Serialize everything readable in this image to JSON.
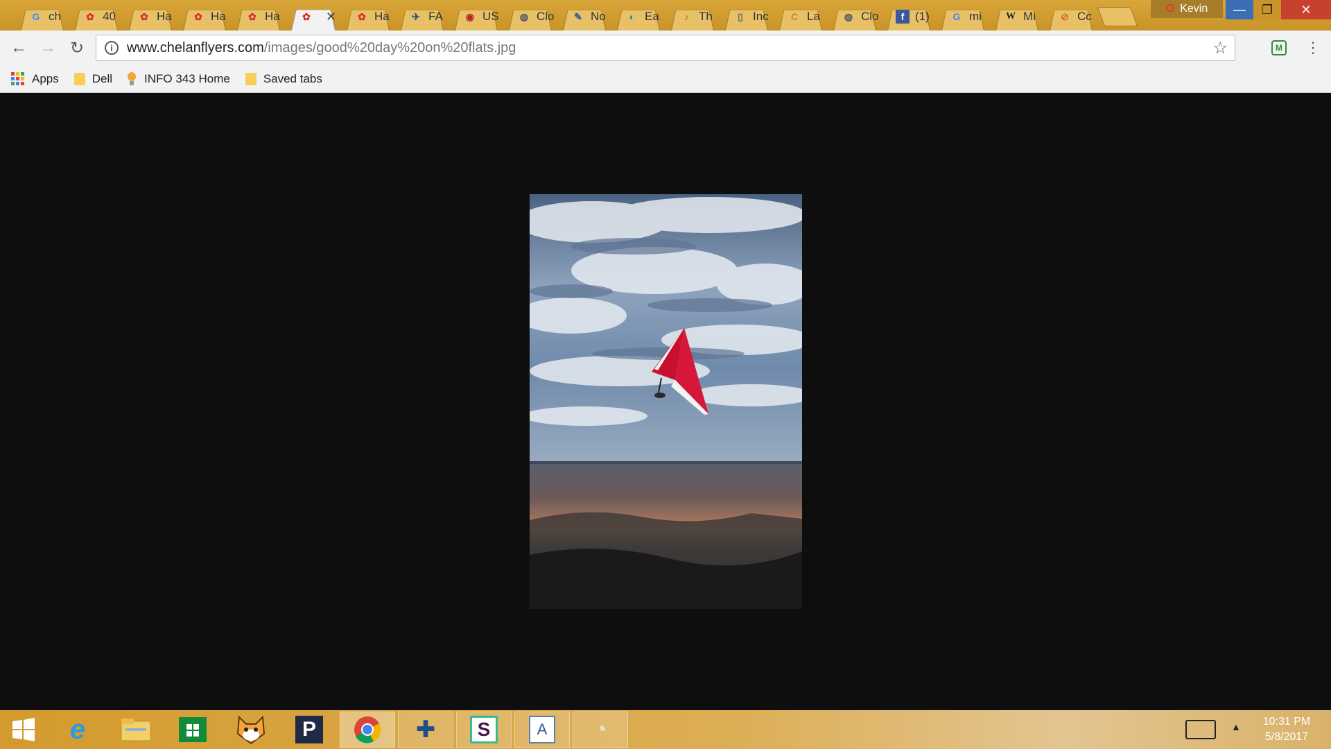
{
  "tabs": [
    {
      "label": "ch",
      "icon": "google-icon",
      "active": false
    },
    {
      "label": "40",
      "icon": "flower-icon",
      "active": false
    },
    {
      "label": "Ha",
      "icon": "flower-icon",
      "active": false
    },
    {
      "label": "Ha",
      "icon": "flower-icon",
      "active": false
    },
    {
      "label": "Ha",
      "icon": "flower-icon",
      "active": false
    },
    {
      "label": "",
      "icon": "flower-icon",
      "active": true
    },
    {
      "label": "Ha",
      "icon": "flower-icon",
      "active": false
    },
    {
      "label": "FA",
      "icon": "airplane-icon",
      "active": false
    },
    {
      "label": "US",
      "icon": "shield-icon",
      "active": false
    },
    {
      "label": "Clo",
      "icon": "globe-icon",
      "active": false
    },
    {
      "label": "No",
      "icon": "pencil-icon",
      "active": false
    },
    {
      "label": "Ea",
      "icon": "wave-icon",
      "active": false
    },
    {
      "label": "Th",
      "icon": "feather-icon",
      "active": false
    },
    {
      "label": "Inc",
      "icon": "document-icon",
      "active": false
    },
    {
      "label": "La",
      "icon": "c-letter-icon",
      "active": false
    },
    {
      "label": "Clo",
      "icon": "globe-icon",
      "active": false
    },
    {
      "label": "(1)",
      "icon": "facebook-icon",
      "active": false
    },
    {
      "label": "mi",
      "icon": "google-icon",
      "active": false
    },
    {
      "label": "Mi",
      "icon": "wikipedia-icon",
      "active": false
    },
    {
      "label": "Cc",
      "icon": "leaf-icon",
      "active": false
    }
  ],
  "profile_name": "Kevin",
  "window_controls": {
    "minimize": "—",
    "maximize": "❐",
    "close": "✕"
  },
  "toolbar": {
    "back": "←",
    "forward": "→",
    "reload": "↻",
    "url_host": "www.chelanflyers.com",
    "url_path": "/images/good%20day%20on%20flats.jpg",
    "star": "☆",
    "menu": "⋮"
  },
  "bookmarks": [
    {
      "label": "Apps",
      "icon": "apps-grid-icon"
    },
    {
      "label": "Dell",
      "icon": "folder-icon"
    },
    {
      "label": "INFO 343 Home",
      "icon": "lightbulb-icon"
    },
    {
      "label": "Saved tabs",
      "icon": "folder-icon"
    }
  ],
  "taskbar": {
    "apps": [
      {
        "name": "start",
        "icon": "windows-logo-icon"
      },
      {
        "name": "internet-explorer",
        "icon": "ie-icon"
      },
      {
        "name": "file-explorer",
        "icon": "folder-icon"
      },
      {
        "name": "store",
        "icon": "store-icon"
      },
      {
        "name": "scratch",
        "icon": "scratch-cat-icon"
      },
      {
        "name": "pandora",
        "icon": "pandora-icon"
      },
      {
        "name": "chrome",
        "icon": "chrome-icon"
      },
      {
        "name": "tableau",
        "icon": "tableau-icon"
      },
      {
        "name": "slack",
        "icon": "slack-icon"
      },
      {
        "name": "wordpad",
        "icon": "wordpad-icon"
      },
      {
        "name": "paint",
        "icon": "paint-palette-icon"
      }
    ],
    "time": "10:31 PM",
    "date": "5/8/2017"
  },
  "colors": {
    "taskbar": "#d49a2e",
    "glider_sail": "#c8102e",
    "page_background": "#0e0e0e"
  }
}
